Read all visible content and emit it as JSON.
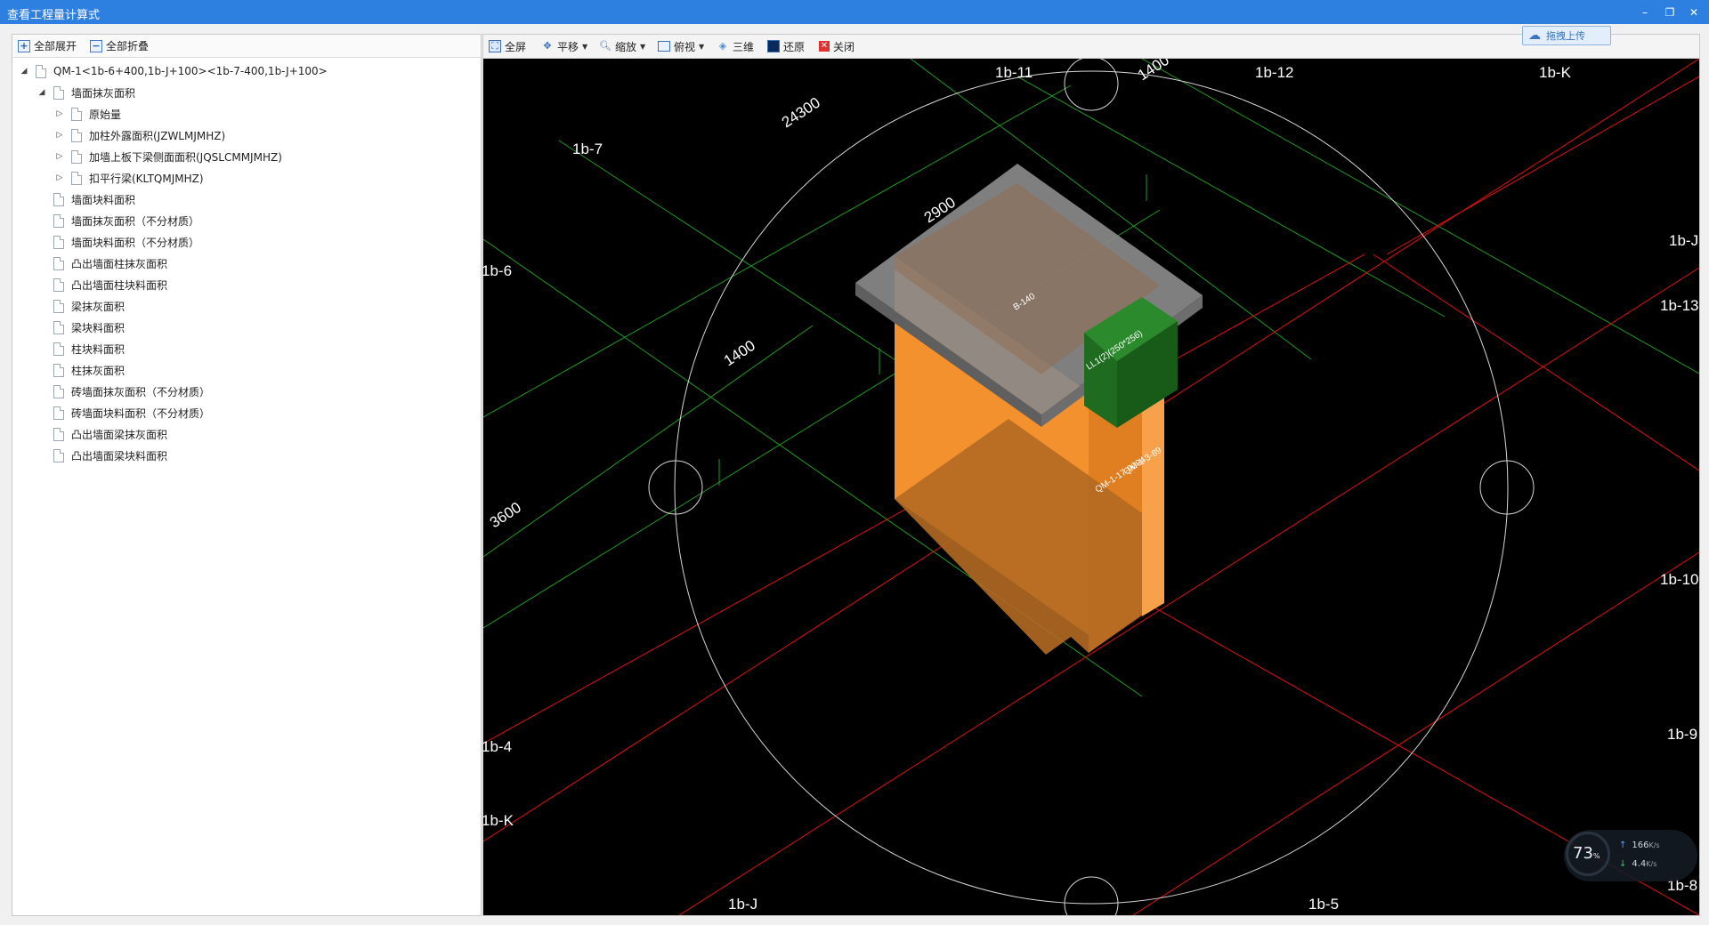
{
  "window": {
    "title": "查看工程量计算式",
    "min_label": "–",
    "restore_label": "❐",
    "close_label": "✕"
  },
  "left_toolbar": {
    "expand_all": "全部展开",
    "collapse_all": "全部折叠"
  },
  "tree": {
    "root": "QM-1<1b-6+400,1b-J+100><1b-7-400,1b-J+100>",
    "group": "墙面抹灰面积",
    "sub_items": [
      "原始量",
      "加柱外露面积(JZWLMJMHZ)",
      "加墙上板下梁侧面面积(JQSLCMMJMHZ)",
      "扣平行梁(KLTQMJMHZ)"
    ],
    "items": [
      "墙面块料面积",
      "墙面抹灰面积（不分材质）",
      "墙面块料面积（不分材质）",
      "凸出墙面柱抹灰面积",
      "凸出墙面柱块料面积",
      "梁抹灰面积",
      "梁块料面积",
      "柱块料面积",
      "柱抹灰面积",
      "砖墙面抹灰面积（不分材质）",
      "砖墙面块料面积（不分材质）",
      "凸出墙面梁抹灰面积",
      "凸出墙面梁块料面积"
    ]
  },
  "right_toolbar": {
    "fullscreen": "全屏",
    "pan": "平移",
    "zoom": "缩放",
    "topview": "俯视",
    "threed": "三维",
    "restore": "还原",
    "close": "关闭"
  },
  "upload_label": "拖拽上传",
  "viewport": {
    "axis_labels": {
      "a1": "1b-11",
      "a2": "1b-12",
      "a3": "1b-K",
      "a4": "1b-7",
      "a5": "1b-J",
      "a6": "1b-6",
      "a7": "1b-13",
      "a8": "1b-10",
      "a9": "1b-9",
      "a10": "1b-4",
      "a11": "1b-K",
      "a12": "1b-J",
      "a13": "1b-5",
      "a14": "1b-8"
    },
    "dims": {
      "d1": "24300",
      "d2": "1400",
      "d3": "2900",
      "d4": "1400",
      "d5": "3600"
    },
    "element_labels": {
      "slab": "B-140",
      "beam": "LL1(2)(250*256)",
      "wall1": "QM-1-17-0094",
      "wall2": "QM-1-3-89"
    },
    "colors": {
      "wall": "#f3912f",
      "slab": "#7a7a7a",
      "beam": "#1f6b1f",
      "grid_red": "#e01010",
      "grid_green": "#1f9a1f"
    }
  },
  "gauge": {
    "percent": "73",
    "percent_unit": "%",
    "up": "166",
    "down": "4.4",
    "rate_unit": "K/s"
  }
}
